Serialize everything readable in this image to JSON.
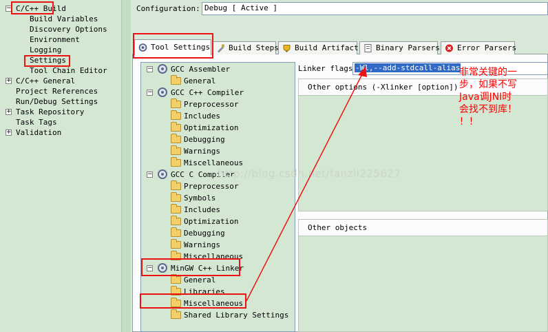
{
  "left_tree": {
    "items": [
      {
        "label": "C/C++ Build",
        "toggle": "-"
      },
      {
        "label": "Build Variables"
      },
      {
        "label": "Discovery Options"
      },
      {
        "label": "Environment"
      },
      {
        "label": "Logging"
      },
      {
        "label": "Settings"
      },
      {
        "label": "Tool Chain Editor"
      },
      {
        "label": "C/C++ General",
        "toggle": "+"
      },
      {
        "label": "Project References"
      },
      {
        "label": "Run/Debug Settings"
      },
      {
        "label": "Task Repository",
        "toggle": "+"
      },
      {
        "label": "Task Tags"
      },
      {
        "label": "Validation",
        "toggle": "+"
      }
    ]
  },
  "configuration": {
    "label": "Configuration:",
    "value": "Debug  [ Active ]"
  },
  "tabs": [
    {
      "label": "Tool Settings",
      "icon": "tool-settings-icon",
      "active": true
    },
    {
      "label": "Build Steps",
      "icon": "build-steps-icon"
    },
    {
      "label": "Build Artifact",
      "icon": "build-artifact-icon"
    },
    {
      "label": "Binary Parsers",
      "icon": "binary-parsers-icon"
    },
    {
      "label": "Error Parsers",
      "icon": "error-parsers-icon"
    }
  ],
  "tool_tree": {
    "gcc_assembler": {
      "label": "GCC Assembler",
      "children": [
        "General"
      ]
    },
    "gcc_cpp_compiler": {
      "label": "GCC C++ Compiler",
      "children": [
        "Preprocessor",
        "Includes",
        "Optimization",
        "Debugging",
        "Warnings",
        "Miscellaneous"
      ]
    },
    "gcc_c_compiler": {
      "label": "GCC C Compiler",
      "children": [
        "Preprocessor",
        "Symbols",
        "Includes",
        "Optimization",
        "Debugging",
        "Warnings",
        "Miscellaneous"
      ]
    },
    "mingw_linker": {
      "label": "MinGW C++ Linker",
      "children": [
        "General",
        "Libraries",
        "Miscellaneous",
        "Shared Library Settings"
      ]
    }
  },
  "settings": {
    "linker_flags_label": "Linker flags",
    "linker_flags_value": "-Wl,--add-stdcall-alias",
    "other_options_label": "Other options (-Xlinker [option])",
    "other_objects_label": "Other objects"
  },
  "watermark": "http://blog.csdn.net/fanzil225627",
  "annotation": "非常关键的一\n步，如果不写\nJava调JNI时\n会找不到库！\n！！",
  "colors": {
    "highlight_red": "#ee1111",
    "selection_blue": "#316ac5",
    "tree_green": "#d3e7d3"
  }
}
